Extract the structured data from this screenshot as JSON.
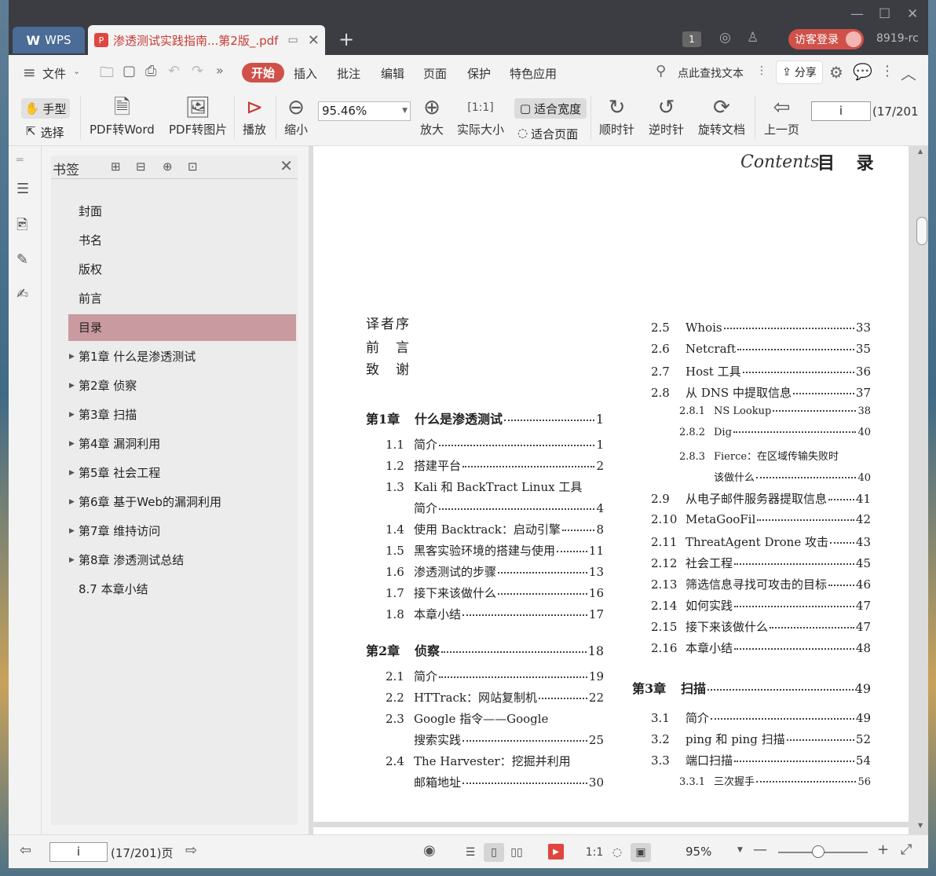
{
  "app": {
    "name": "WPS",
    "doc_tab": "渗透测试实践指南...第2版_.pdf",
    "badge": "1",
    "login": "访客登录",
    "version": "8919-rc"
  },
  "menu": {
    "file": "文件",
    "items": [
      "开始",
      "插入",
      "批注",
      "编辑",
      "页面",
      "保护",
      "特色应用"
    ],
    "search": "点此查找文本",
    "share": "分享"
  },
  "toolbar": {
    "hand": "手型",
    "select": "选择",
    "pdf2word": "PDF转Word",
    "pdf2img": "PDF转图片",
    "play": "播放",
    "zoom_out": "缩小",
    "zoom_value": "95.46%",
    "zoom_in": "放大",
    "actual": "实际大小",
    "fit_width": "适合宽度",
    "fit_page": "适合页面",
    "cw": "顺时针",
    "ccw": "逆时针",
    "rotate": "旋转文档",
    "prev": "上一页",
    "page_input": "i",
    "page_total": "(17/201"
  },
  "bookmarks": {
    "title": "书签",
    "items": [
      {
        "label": "封面",
        "arrow": ""
      },
      {
        "label": "书名",
        "arrow": ""
      },
      {
        "label": "版权",
        "arrow": ""
      },
      {
        "label": "前言",
        "arrow": ""
      },
      {
        "label": "目录",
        "arrow": "",
        "active": true
      },
      {
        "label": "第1章  什么是渗透测试",
        "arrow": "▶"
      },
      {
        "label": "第2章  侦察",
        "arrow": "▶"
      },
      {
        "label": "第3章  扫描",
        "arrow": "▶"
      },
      {
        "label": "第4章  漏洞利用",
        "arrow": "▶"
      },
      {
        "label": "第5章  社会工程",
        "arrow": "▶"
      },
      {
        "label": "第6章  基于Web的漏洞利用",
        "arrow": "▶"
      },
      {
        "label": "第7章  维持访问",
        "arrow": "▶"
      },
      {
        "label": "第8章  渗透测试总结",
        "arrow": "▶"
      },
      {
        "label": "8.7  本章小结",
        "arrow": ""
      }
    ]
  },
  "toc": {
    "header_script": "Contents",
    "header": "目 录",
    "front": [
      "译者序",
      "前　言",
      "致　谢"
    ],
    "left": [
      {
        "n": "第1章",
        "t": "什么是渗透测试",
        "p": "1",
        "kind": "chap"
      },
      {
        "n": "1.1",
        "t": "简介",
        "p": "1",
        "kind": "sec"
      },
      {
        "n": "1.2",
        "t": "搭建平台",
        "p": "2",
        "kind": "sec"
      },
      {
        "n": "1.3",
        "t": "Kali 和 BackTract Linux 工具",
        "p": "",
        "kind": "sec"
      },
      {
        "n": "",
        "t": "简介",
        "p": "4",
        "kind": "cont"
      },
      {
        "n": "1.4",
        "t": "使用 Backtrack：启动引擎",
        "p": "8",
        "kind": "sec"
      },
      {
        "n": "1.5",
        "t": "黑客实验环境的搭建与使用",
        "p": "11",
        "kind": "sec"
      },
      {
        "n": "1.6",
        "t": "渗透测试的步骤",
        "p": "13",
        "kind": "sec"
      },
      {
        "n": "1.7",
        "t": "接下来该做什么",
        "p": "16",
        "kind": "sec"
      },
      {
        "n": "1.8",
        "t": "本章小结",
        "p": "17",
        "kind": "sec"
      },
      {
        "n": "第2章",
        "t": "侦察",
        "p": "18",
        "kind": "chap"
      },
      {
        "n": "2.1",
        "t": "简介",
        "p": "19",
        "kind": "sec"
      },
      {
        "n": "2.2",
        "t": "HTTrack：网站复制机",
        "p": "22",
        "kind": "sec"
      },
      {
        "n": "2.3",
        "t": "Google 指令——Google",
        "p": "",
        "kind": "sec"
      },
      {
        "n": "",
        "t": "搜索实践",
        "p": "25",
        "kind": "cont"
      },
      {
        "n": "2.4",
        "t": "The Harvester：挖掘并利用",
        "p": "",
        "kind": "sec"
      },
      {
        "n": "",
        "t": "邮箱地址",
        "p": "30",
        "kind": "cont"
      }
    ],
    "right": [
      {
        "n": "2.5",
        "t": "Whois",
        "p": "33",
        "kind": "sec"
      },
      {
        "n": "2.6",
        "t": "Netcraft",
        "p": "35",
        "kind": "sec"
      },
      {
        "n": "2.7",
        "t": "Host 工具",
        "p": "36",
        "kind": "sec"
      },
      {
        "n": "2.8",
        "t": "从 DNS 中提取信息",
        "p": "37",
        "kind": "sec"
      },
      {
        "n": "2.8.1",
        "t": "NS Lookup",
        "p": "38",
        "kind": "sub"
      },
      {
        "n": "2.8.2",
        "t": "Dig",
        "p": "40",
        "kind": "sub"
      },
      {
        "n": "2.8.3",
        "t": "Fierce：在区域传输失败时",
        "p": "",
        "kind": "sub"
      },
      {
        "n": "",
        "t": "该做什么",
        "p": "40",
        "kind": "subcont"
      },
      {
        "n": "2.9",
        "t": "从电子邮件服务器提取信息",
        "p": "41",
        "kind": "sec"
      },
      {
        "n": "2.10",
        "t": "MetaGooFil",
        "p": "42",
        "kind": "sec"
      },
      {
        "n": "2.11",
        "t": "ThreatAgent Drone 攻击",
        "p": "43",
        "kind": "sec"
      },
      {
        "n": "2.12",
        "t": "社会工程",
        "p": "45",
        "kind": "sec"
      },
      {
        "n": "2.13",
        "t": "筛选信息寻找可攻击的目标",
        "p": "46",
        "kind": "sec"
      },
      {
        "n": "2.14",
        "t": "如何实践",
        "p": "47",
        "kind": "sec"
      },
      {
        "n": "2.15",
        "t": "接下来该做什么",
        "p": "47",
        "kind": "sec"
      },
      {
        "n": "2.16",
        "t": "本章小结",
        "p": "48",
        "kind": "sec"
      },
      {
        "n": "第3章",
        "t": "扫描",
        "p": "49",
        "kind": "chap"
      },
      {
        "n": "3.1",
        "t": "简介",
        "p": "49",
        "kind": "sec"
      },
      {
        "n": "3.2",
        "t": "ping 和 ping 扫描",
        "p": "52",
        "kind": "sec"
      },
      {
        "n": "3.3",
        "t": "端口扫描",
        "p": "54",
        "kind": "sec"
      },
      {
        "n": "3.3.1",
        "t": "三次握手",
        "p": "56",
        "kind": "sub"
      }
    ]
  },
  "status": {
    "page_input": "i",
    "page_total": "(17/201)页",
    "zoom": "95%"
  }
}
